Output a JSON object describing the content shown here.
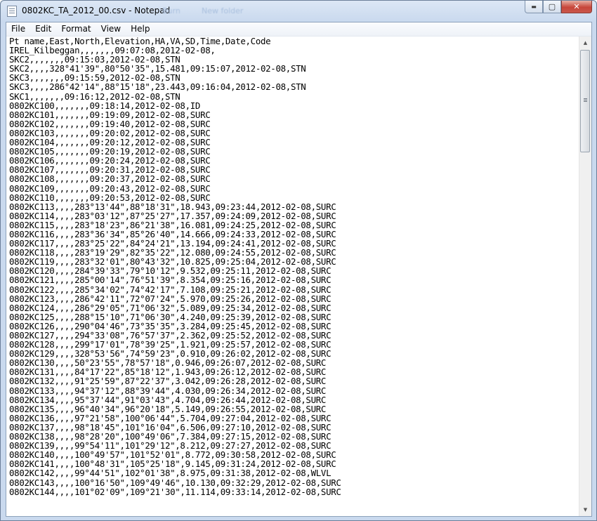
{
  "window": {
    "title": "0802KC_TA_2012_00.csv - Notepad",
    "ghost_items": [
      "Burn",
      "New folder"
    ]
  },
  "controls": {
    "minimize": "▬",
    "maximize": "▢",
    "close": "✕"
  },
  "menu": [
    "File",
    "Edit",
    "Format",
    "View",
    "Help"
  ],
  "lines": [
    "Pt name,East,North,Elevation,HA,VA,SD,Time,Date,Code",
    "IREL_Kilbeggan,,,,,,,09:07:08,2012-02-08,",
    "SKC2,,,,,,,09:15:03,2012-02-08,STN",
    "SKC2,,,,328°41'39\",80°50'35\",15.481,09:15:07,2012-02-08,STN",
    "SKC3,,,,,,,09:15:59,2012-02-08,STN",
    "SKC3,,,,286°42'14\",88°15'18\",23.443,09:16:04,2012-02-08,STN",
    "SKC1,,,,,,,09:16:12,2012-02-08,STN",
    "0802KC100,,,,,,,09:18:14,2012-02-08,ID",
    "0802KC101,,,,,,,09:19:09,2012-02-08,SURC",
    "0802KC102,,,,,,,09:19:40,2012-02-08,SURC",
    "0802KC103,,,,,,,09:20:02,2012-02-08,SURC",
    "0802KC104,,,,,,,09:20:12,2012-02-08,SURC",
    "0802KC105,,,,,,,09:20:19,2012-02-08,SURC",
    "0802KC106,,,,,,,09:20:24,2012-02-08,SURC",
    "0802KC107,,,,,,,09:20:31,2012-02-08,SURC",
    "0802KC108,,,,,,,09:20:37,2012-02-08,SURC",
    "0802KC109,,,,,,,09:20:43,2012-02-08,SURC",
    "0802KC110,,,,,,,09:20:53,2012-02-08,SURC",
    "0802KC113,,,,283°13'44\",88°18'31\",18.943,09:23:44,2012-02-08,SURC",
    "0802KC114,,,,283°03'12\",87°25'27\",17.357,09:24:09,2012-02-08,SURC",
    "0802KC115,,,,283°18'23\",86°21'38\",16.081,09:24:25,2012-02-08,SURC",
    "0802KC116,,,,283°36'34\",85°26'40\",14.666,09:24:33,2012-02-08,SURC",
    "0802KC117,,,,283°25'22\",84°24'21\",13.194,09:24:41,2012-02-08,SURC",
    "0802KC118,,,,283°19'29\",82°35'22\",12.080,09:24:55,2012-02-08,SURC",
    "0802KC119,,,,283°32'01\",80°43'32\",10.825,09:25:04,2012-02-08,SURC",
    "0802KC120,,,,284°39'33\",79°10'12\",9.532,09:25:11,2012-02-08,SURC",
    "0802KC121,,,,285°00'14\",76°51'39\",8.354,09:25:16,2012-02-08,SURC",
    "0802KC122,,,,285°34'02\",74°42'17\",7.108,09:25:21,2012-02-08,SURC",
    "0802KC123,,,,286°42'11\",72°07'24\",5.970,09:25:26,2012-02-08,SURC",
    "0802KC124,,,,286°29'05\",71°06'32\",5.089,09:25:34,2012-02-08,SURC",
    "0802KC125,,,,288°15'10\",71°06'30\",4.240,09:25:39,2012-02-08,SURC",
    "0802KC126,,,,290°04'46\",73°35'35\",3.284,09:25:45,2012-02-08,SURC",
    "0802KC127,,,,294°33'08\",76°57'37\",2.362,09:25:52,2012-02-08,SURC",
    "0802KC128,,,,299°17'01\",78°39'25\",1.921,09:25:57,2012-02-08,SURC",
    "0802KC129,,,,328°53'56\",74°59'23\",0.910,09:26:02,2012-02-08,SURC",
    "0802KC130,,,,50°23'55\",78°57'18\",0.946,09:26:07,2012-02-08,SURC",
    "0802KC131,,,,84°17'22\",85°18'12\",1.943,09:26:12,2012-02-08,SURC",
    "0802KC132,,,,91°25'59\",87°22'37\",3.042,09:26:28,2012-02-08,SURC",
    "0802KC133,,,,94°37'12\",88°39'44\",4.030,09:26:34,2012-02-08,SURC",
    "0802KC134,,,,95°37'44\",91°03'43\",4.704,09:26:44,2012-02-08,SURC",
    "0802KC135,,,,96°40'34\",96°20'18\",5.149,09:26:55,2012-02-08,SURC",
    "0802KC136,,,,97°21'58\",100°06'44\",5.704,09:27:04,2012-02-08,SURC",
    "0802KC137,,,,98°18'45\",101°16'04\",6.506,09:27:10,2012-02-08,SURC",
    "0802KC138,,,,98°28'20\",100°49'06\",7.384,09:27:15,2012-02-08,SURC",
    "0802KC139,,,,99°54'11\",101°29'12\",8.212,09:27:27,2012-02-08,SURC",
    "0802KC140,,,,100°49'57\",101°52'01\",8.772,09:30:58,2012-02-08,SURC",
    "0802KC141,,,,100°48'31\",105°25'18\",9.145,09:31:24,2012-02-08,SURC",
    "0802KC142,,,,99°44'51\",102°01'38\",8.975,09:31:38,2012-02-08,WLVL",
    "0802KC143,,,,100°16'50\",109°49'46\",10.130,09:32:29,2012-02-08,SURC",
    "0802KC144,,,,101°02'09\",109°21'30\",11.114,09:33:14,2012-02-08,SURC"
  ]
}
